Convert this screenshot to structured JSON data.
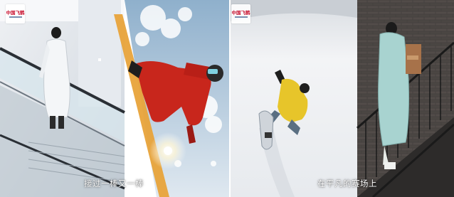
{
  "frames": [
    {
      "logo": {
        "text": "中国飞鹤"
      },
      "caption": "接过一棒又一棒"
    },
    {
      "logo": {
        "text": "中国飞鹤"
      },
      "caption": "在平凡的赛场上"
    }
  ],
  "colors": {
    "accent_orange": "#e8a33a",
    "jacket_red": "#c8261c",
    "jacket_yellow": "#e7c52a",
    "coat_mint": "#a8d3d0",
    "brick": "#45413f",
    "snow": "#f3f4f6"
  }
}
